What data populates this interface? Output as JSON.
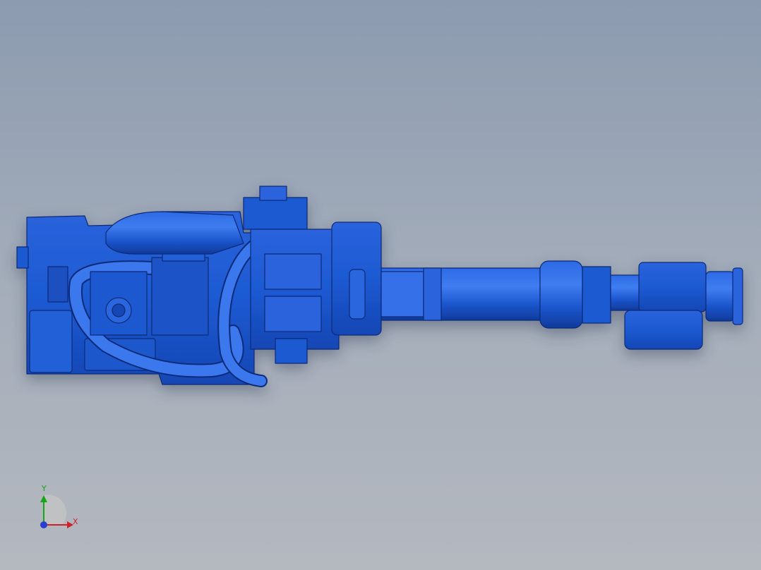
{
  "viewport": {
    "background_top": "#8c9bb0",
    "background_bottom": "#b4b8bf"
  },
  "model": {
    "body_color": "#1d5ad2",
    "edge_color": "#0a2b78",
    "highlight_color": "#3f7df0"
  },
  "triad": {
    "x_label": "X",
    "y_label": "Y",
    "x_color": "#d0202a",
    "y_color": "#16a516",
    "z_color": "#2a3fd0"
  }
}
